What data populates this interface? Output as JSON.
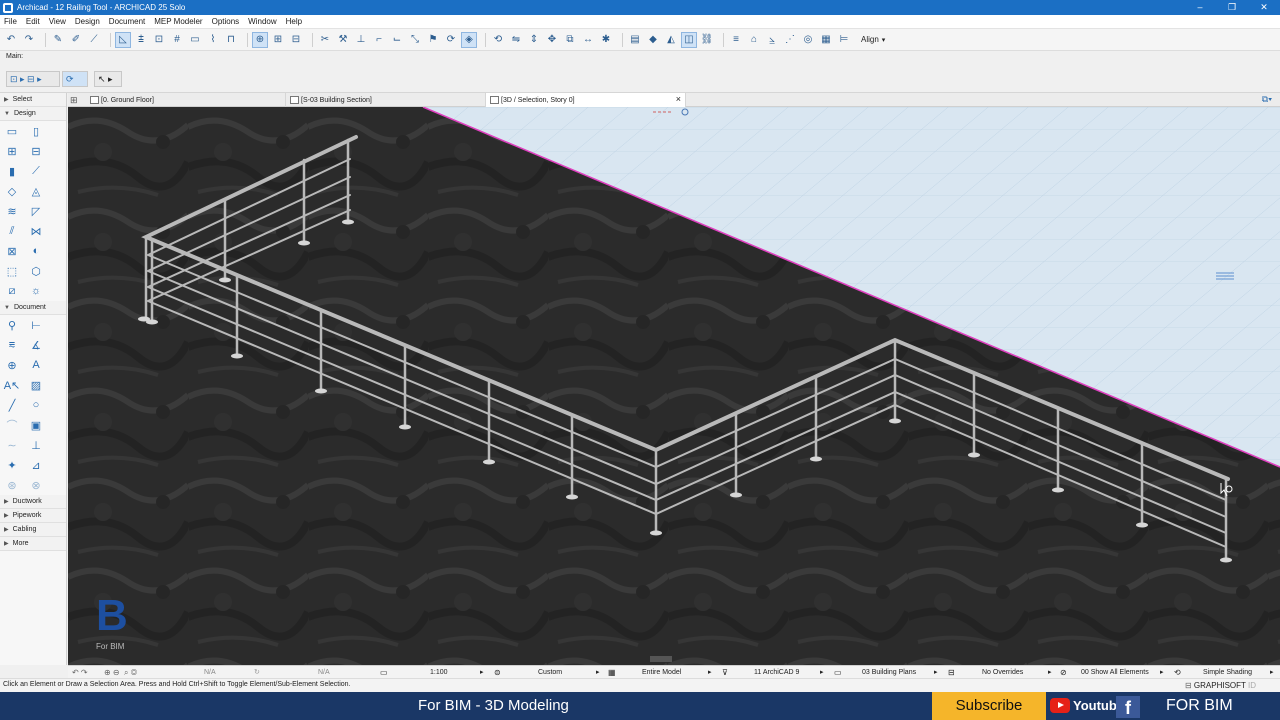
{
  "window": {
    "title": "Archicad - 12 Railing Tool - ARCHICAD 25 Solo",
    "controls": [
      "–",
      "❐",
      "✕"
    ]
  },
  "menu": [
    "File",
    "Edit",
    "View",
    "Design",
    "Document",
    "MEP Modeler",
    "Options",
    "Window",
    "Help"
  ],
  "toolbar": {
    "align_label": "Align",
    "main_label": "Main:"
  },
  "tabs": [
    {
      "label": "[0. Ground Floor]"
    },
    {
      "label": "[S-03 Building Section]"
    },
    {
      "label": "[3D / Selection, Story 0]"
    }
  ],
  "toolbox": {
    "select": "Select",
    "design": "Design",
    "document": "Document",
    "ductwork": "Ductwork",
    "pipework": "Pipework",
    "cabling": "Cabling",
    "more": "More"
  },
  "status": {
    "na1": "N/A",
    "na2": "N/A",
    "scale": "1:100",
    "custom": "Custom",
    "model": "Entire Model",
    "pen_set": "11 ArchiCAD 9",
    "layer_combo": "03 Building Plans",
    "overrides": "No Overrides",
    "renovation": "00 Show All Elements",
    "shading": "Simple Shading"
  },
  "hint": "Click an Element or Draw a Selection Area. Press and Hold Ctrl+Shift to Toggle Element/Sub-Element Selection.",
  "graphisoft": {
    "name": "GRAPHISOFT",
    "id": "ID"
  },
  "watermark": {
    "letter": "B",
    "text": "For BIM"
  },
  "banner": {
    "title": "For BIM - 3D Modeling",
    "subscribe": "Subscribe",
    "youtube": "Youtube",
    "facebook": "f",
    "brand": "FOR BIM"
  },
  "colors": {
    "titlebar": "#1b6fc4",
    "banner": "#1a3766",
    "subscribe": "#f5b52a",
    "slab_edge": "#e040c0"
  }
}
